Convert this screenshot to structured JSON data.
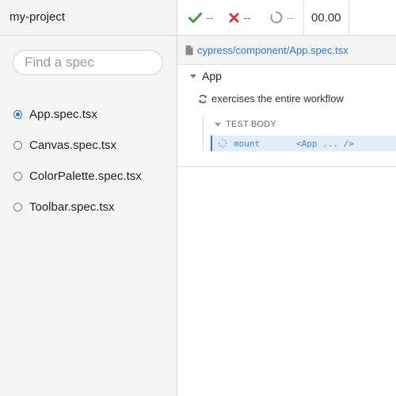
{
  "sidebar": {
    "project_title": "my-project",
    "search": {
      "placeholder": "Find a spec",
      "value": ""
    },
    "specs": [
      {
        "label": "App.spec.tsx",
        "selected": true
      },
      {
        "label": "Canvas.spec.tsx",
        "selected": false
      },
      {
        "label": "ColorPalette.spec.tsx",
        "selected": false
      },
      {
        "label": "Toolbar.spec.tsx",
        "selected": false
      }
    ]
  },
  "stats": {
    "passed": "--",
    "failed": "--",
    "pending": "--",
    "duration": "00.00",
    "colors": {
      "pass": "#3c9c3c",
      "fail": "#d53b3b",
      "pending": "#9a9a9a"
    }
  },
  "spec_header": {
    "icon": "file-icon",
    "path": "cypress/component/App.spec.tsx"
  },
  "runner": {
    "suite": "App",
    "test": "exercises the entire workflow",
    "section": "TEST BODY",
    "command": {
      "name": "mount",
      "message": "<App ... />",
      "icon": "spinner-icon"
    }
  }
}
